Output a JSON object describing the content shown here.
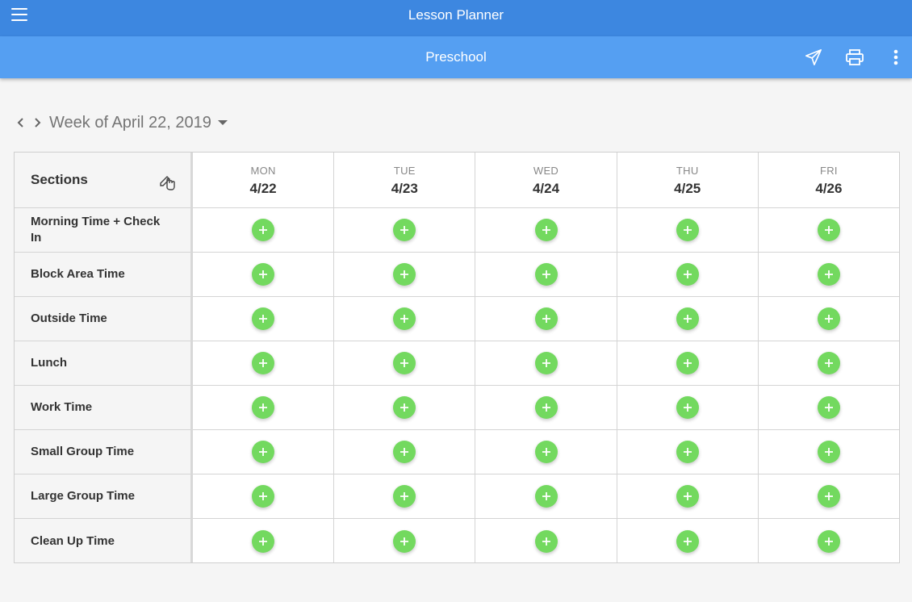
{
  "app": {
    "title": "Lesson Planner"
  },
  "subheader": {
    "title": "Preschool"
  },
  "toolbar": {
    "send_icon": "send-icon",
    "print_icon": "print-icon",
    "more_icon": "more-vertical-icon"
  },
  "week": {
    "label": "Week of April 22, 2019"
  },
  "planner": {
    "sections_header": "Sections",
    "days": [
      {
        "dow": "MON",
        "date": "4/22"
      },
      {
        "dow": "TUE",
        "date": "4/23"
      },
      {
        "dow": "WED",
        "date": "4/24"
      },
      {
        "dow": "THU",
        "date": "4/25"
      },
      {
        "dow": "FRI",
        "date": "4/26"
      }
    ],
    "sections": [
      "Morning Time + Check In",
      "Block Area Time",
      "Outside Time",
      "Lunch",
      "Work Time",
      "Small Group Time",
      "Large Group Time",
      "Clean Up Time"
    ]
  },
  "colors": {
    "topbar": "#3d87e0",
    "subbar": "#559ff2",
    "add_button": "#73d95f"
  }
}
